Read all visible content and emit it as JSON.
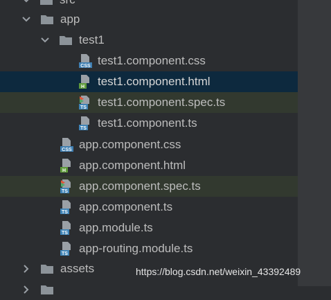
{
  "tree": {
    "partial_top": "src",
    "app": "app",
    "test1": "test1",
    "files": [
      {
        "label": "test1.component.css",
        "type": "CSS"
      },
      {
        "label": "test1.component.html",
        "type": "H"
      },
      {
        "label": "test1.component.spec.ts",
        "type": "TS"
      },
      {
        "label": "test1.component.ts",
        "type": "TS"
      },
      {
        "label": "app.component.css",
        "type": "CSS"
      },
      {
        "label": "app.component.html",
        "type": "H"
      },
      {
        "label": "app.component.spec.ts",
        "type": "TS"
      },
      {
        "label": "app.component.ts",
        "type": "TS"
      },
      {
        "label": "app.module.ts",
        "type": "TS"
      },
      {
        "label": "app-routing.module.ts",
        "type": "TS"
      }
    ],
    "assets": "assets"
  },
  "watermark": "https://blog.csdn.net/weixin_43392489",
  "colors": {
    "background": "#2b2d30",
    "selected_row": "#0d293e",
    "spec_row": "#32392f",
    "folder": "#8c9399",
    "css_badge": "#3f7fb2",
    "html_badge": "#5f9a3b",
    "ts_badge": "#3f84b7",
    "text": "#bdbdbd"
  }
}
